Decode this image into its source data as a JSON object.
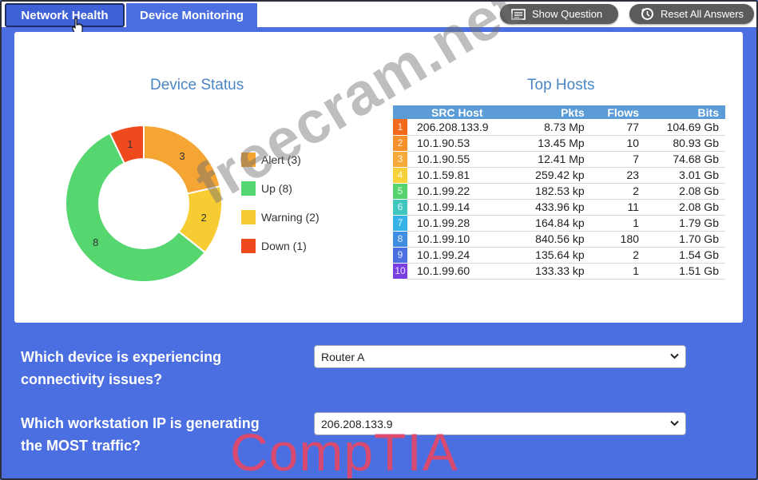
{
  "tabs": [
    {
      "label": "Network Health",
      "active": true
    },
    {
      "label": "Device Monitoring",
      "active": false
    }
  ],
  "toolbar": {
    "show_question": "Show Question",
    "reset_answers": "Reset All Answers"
  },
  "device_status": {
    "title": "Device Status",
    "legend": [
      {
        "label": "Alert (3)",
        "color": "#f5a533"
      },
      {
        "label": "Up (8)",
        "color": "#56d66e"
      },
      {
        "label": "Warning (2)",
        "color": "#f7cc33"
      },
      {
        "label": "Down (1)",
        "color": "#ef4a1e"
      }
    ]
  },
  "chart_data": {
    "type": "pie",
    "title": "Device Status",
    "categories": [
      "Alert",
      "Warning",
      "Up",
      "Down"
    ],
    "values": [
      3,
      2,
      8,
      1
    ],
    "slice_labels": [
      "3",
      "2",
      "8",
      "1"
    ],
    "colors": [
      "#f5a533",
      "#f7cc33",
      "#56d66e",
      "#ef4a1e"
    ],
    "donut": true,
    "legend_placement": "right"
  },
  "top_hosts": {
    "title": "Top Hosts",
    "columns": [
      "SRC Host",
      "Pkts",
      "Flows",
      "Bits"
    ],
    "rows": [
      {
        "rank": "1",
        "host": "206.208.133.9",
        "pkts": "8.73 Mp",
        "flows": "77",
        "bits": "104.69 Gb",
        "color": "#f26a1a"
      },
      {
        "rank": "2",
        "host": "10.1.90.53",
        "pkts": "13.45 Mp",
        "flows": "10",
        "bits": "80.93 Gb",
        "color": "#f5902a"
      },
      {
        "rank": "3",
        "host": "10.1.90.55",
        "pkts": "12.41 Mp",
        "flows": "7",
        "bits": "74.68 Gb",
        "color": "#f7a93a"
      },
      {
        "rank": "4",
        "host": "10.1.59.81",
        "pkts": "259.42 kp",
        "flows": "23",
        "bits": "3.01 Gb",
        "color": "#f6d13a"
      },
      {
        "rank": "5",
        "host": "10.1.99.22",
        "pkts": "182.53 kp",
        "flows": "2",
        "bits": "2.08 Gb",
        "color": "#55d36e"
      },
      {
        "rank": "6",
        "host": "10.1.99.14",
        "pkts": "433.96 kp",
        "flows": "11",
        "bits": "2.08 Gb",
        "color": "#3fc7bf"
      },
      {
        "rank": "7",
        "host": "10.1.99.28",
        "pkts": "164.84 kp",
        "flows": "1",
        "bits": "1.79 Gb",
        "color": "#35b3e8"
      },
      {
        "rank": "8",
        "host": "10.1.99.10",
        "pkts": "840.56 kp",
        "flows": "180",
        "bits": "1.70 Gb",
        "color": "#3f8de0"
      },
      {
        "rank": "9",
        "host": "10.1.99.24",
        "pkts": "135.64 kp",
        "flows": "2",
        "bits": "1.54 Gb",
        "color": "#4a6fe0"
      },
      {
        "rank": "10",
        "host": "10.1.99.60",
        "pkts": "133.33 kp",
        "flows": "1",
        "bits": "1.51 Gb",
        "color": "#7a3fe0"
      }
    ]
  },
  "questions": [
    {
      "line1": "Which device is experiencing",
      "line2": "connectivity issues?",
      "selected": "Router A"
    },
    {
      "line1": "Which workstation IP is generating",
      "line2": "the MOST traffic?",
      "selected": "206.208.133.9"
    }
  ],
  "watermark": {
    "site": "freecram.net",
    "brand": "CompTIA"
  }
}
